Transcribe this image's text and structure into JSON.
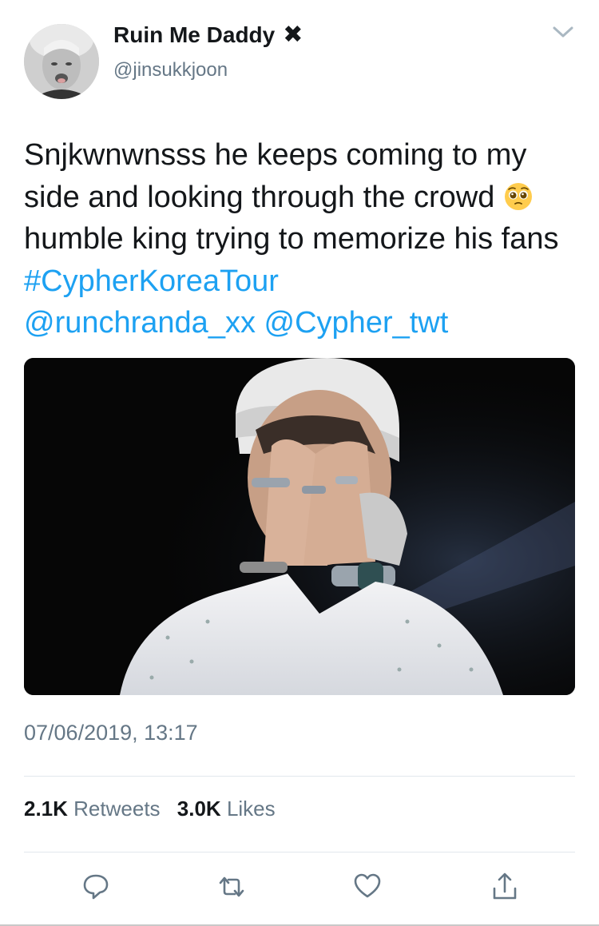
{
  "tweet": {
    "display_name": "Ruin Me Daddy",
    "badge": "✖",
    "handle": "@jinsukkjoon",
    "text_part1": "Snjkwnwnsss he keeps coming to my side and looking through the crowd ",
    "text_part2": " humble king trying to memorize his fans ",
    "hashtag": "#CypherKoreaTour",
    "mention1": "@runchranda_xx",
    "mention2": "@Cypher_twt",
    "emoji": "pleading-face",
    "timestamp": "07/06/2019, 13:17"
  },
  "stats": {
    "retweets_count": "2.1K",
    "retweets_label": "Retweets",
    "likes_count": "3.0K",
    "likes_label": "Likes"
  },
  "actions": {
    "reply_icon": "reply-icon",
    "retweet_icon": "retweet-icon",
    "like_icon": "heart-icon",
    "share_icon": "share-icon"
  },
  "colors": {
    "link": "#1da1f2",
    "muted": "#657786",
    "text": "#14171a",
    "divider": "#e1e8ed"
  }
}
